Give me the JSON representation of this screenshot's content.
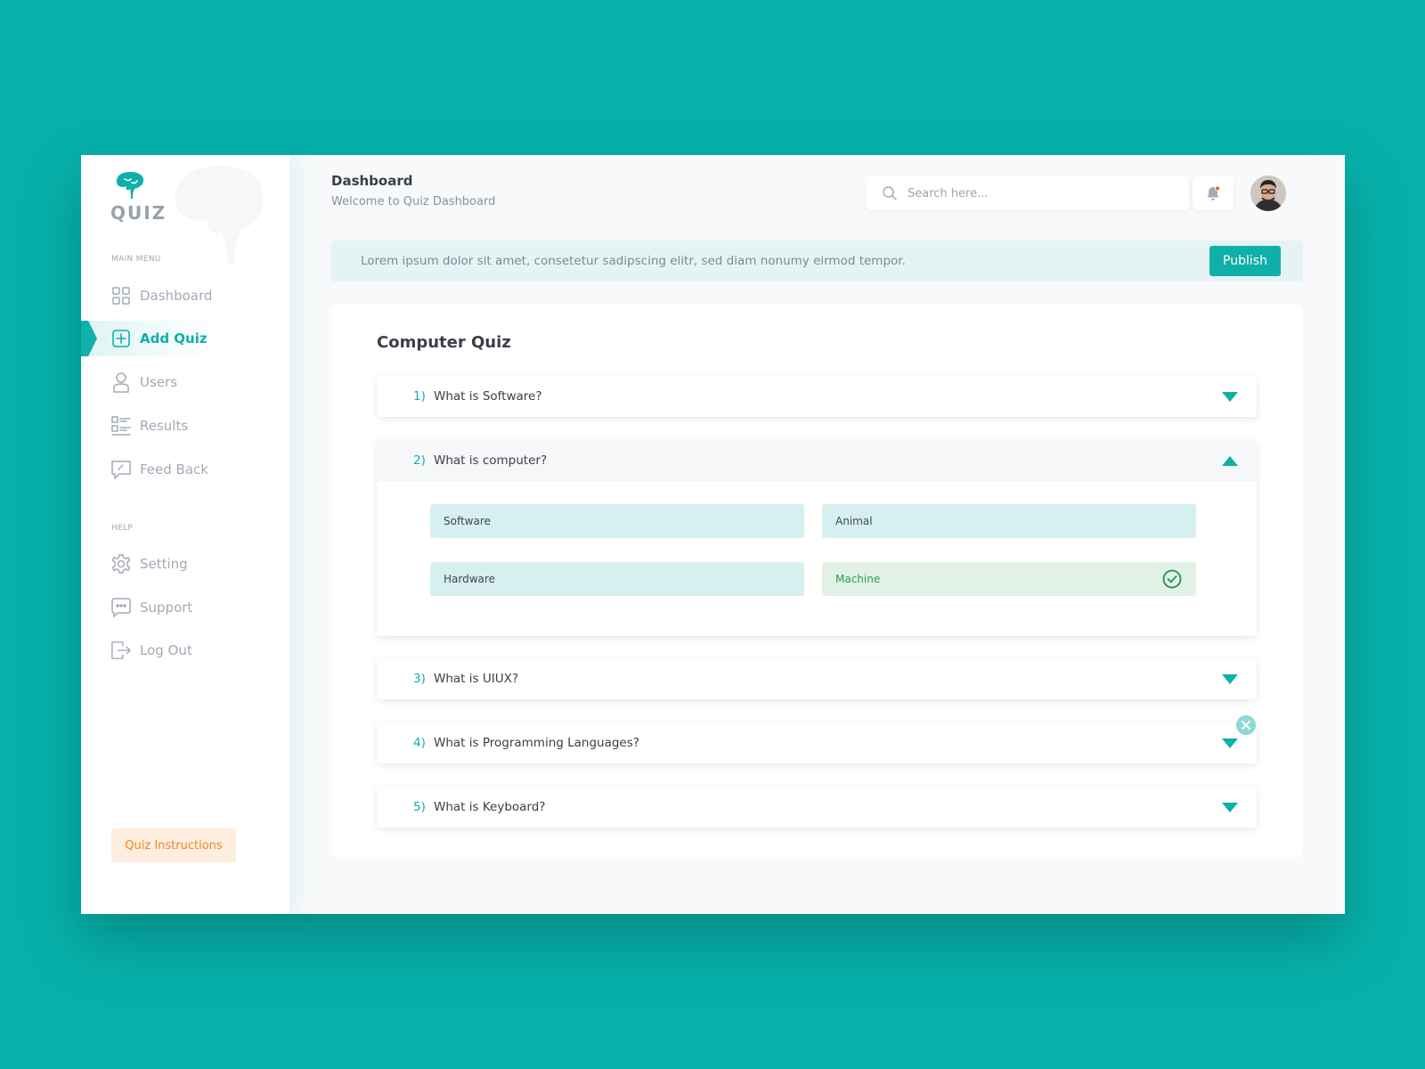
{
  "brand": {
    "name": "QUIZ"
  },
  "sidebar": {
    "main_menu_label": "MAIN MENU",
    "help_label": "HELP",
    "items": [
      {
        "label": "Dashboard",
        "icon": "grid-icon"
      },
      {
        "label": "Add Quiz",
        "icon": "plus-square-icon",
        "active": true
      },
      {
        "label": "Users",
        "icon": "user-icon"
      },
      {
        "label": "Results",
        "icon": "list-icon"
      },
      {
        "label": "Feed Back",
        "icon": "feedback-icon"
      }
    ],
    "help_items": [
      {
        "label": "Setting",
        "icon": "gear-icon"
      },
      {
        "label": "Support",
        "icon": "chat-icon"
      },
      {
        "label": "Log Out",
        "icon": "logout-icon"
      }
    ],
    "instructions_label": "Quiz Instructions"
  },
  "header": {
    "title": "Dashboard",
    "subtitle": "Welcome to Quiz Dashboard",
    "search_placeholder": "Search here..."
  },
  "banner": {
    "text": "Lorem ipsum dolor sit amet, consetetur sadipscing elitr, sed diam nonumy eirmod tempor.",
    "publish_label": "Publish"
  },
  "quiz": {
    "title": "Computer Quiz",
    "questions": [
      {
        "num": "1)",
        "text": "What is Software?"
      },
      {
        "num": "2)",
        "text": "What is computer?",
        "expanded": true,
        "options": [
          {
            "label": "Software"
          },
          {
            "label": "Animal"
          },
          {
            "label": "Hardware"
          },
          {
            "label": "Machine",
            "correct": true
          }
        ]
      },
      {
        "num": "3)",
        "text": "What is UIUX?"
      },
      {
        "num": "4)",
        "text": "What is Programming Languages?"
      },
      {
        "num": "5)",
        "text": "What is Keyboard?"
      }
    ]
  },
  "colors": {
    "background": "#07b1aa",
    "accent": "#0fb0a8",
    "correct": "#2e9a58",
    "instructions": "#f0861f"
  }
}
